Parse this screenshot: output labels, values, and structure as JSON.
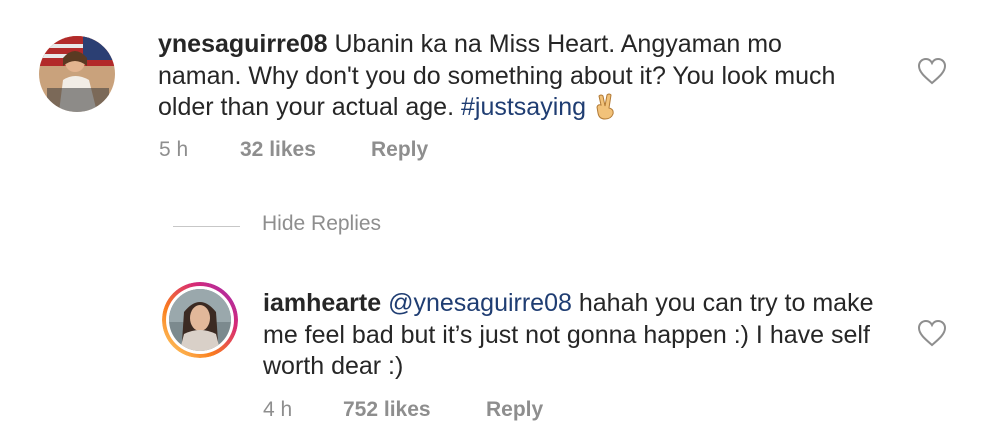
{
  "comments": [
    {
      "username": "ynesaguirre08",
      "text_before": " Ubanin ka na Miss Heart. Angyaman mo naman. Why don't you do something about it? You look much older than your actual age. ",
      "hashtag": "#justsaying",
      "emoji_icon": "victory-hand-icon",
      "time": "5 h",
      "likes": "32 likes",
      "reply_label": "Reply",
      "heart_icon": "heart-outline-icon"
    },
    {
      "username": "iamhearte",
      "mention": "@ynesaguirre08",
      "text_after": " hahah you can try to make me feel bad but it’s just not gonna happen :) I have self worth dear :)",
      "time": "4 h",
      "likes": "752 likes",
      "reply_label": "Reply",
      "heart_icon": "heart-outline-icon",
      "story_ring_colors": [
        "#feda75",
        "#fa7e1e",
        "#d62976",
        "#962fbf"
      ]
    }
  ],
  "hide_replies_label": "Hide Replies"
}
